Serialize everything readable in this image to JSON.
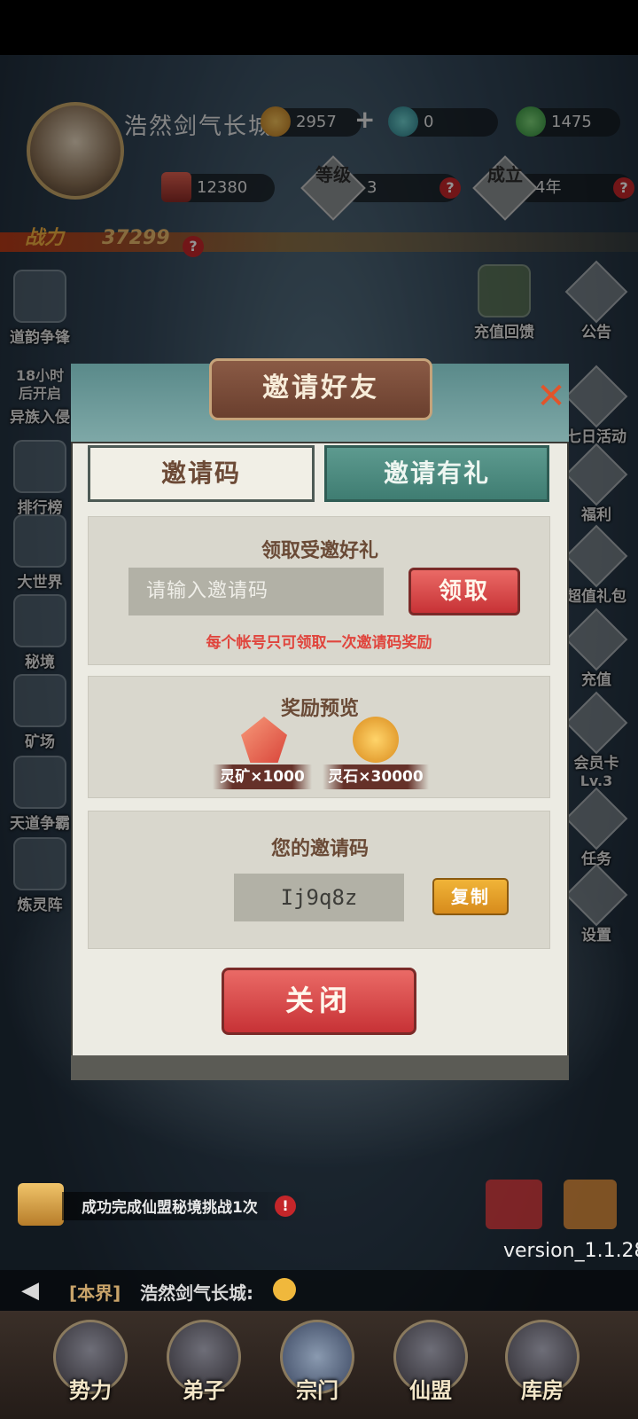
{
  "player": {
    "name": "浩然剑气长城",
    "spirit_stone": "2957",
    "plus": "+",
    "jade": "0",
    "leaf": "1475",
    "crystal": "12380",
    "level_badge": "等级",
    "level_value": "3",
    "founded_badge": "成立",
    "founded_value": "4年",
    "power_icon": "战力",
    "power": "37299"
  },
  "left_menu": [
    {
      "label": "道韵争锋",
      "name": "daoyun"
    },
    {
      "label": "18小时后开启",
      "name": "timer"
    },
    {
      "label": "异族入侵",
      "name": "invasion"
    },
    {
      "label": "排行榜",
      "name": "ranking"
    },
    {
      "label": "大世界",
      "name": "world"
    },
    {
      "label": "秘境",
      "name": "secret-realm"
    },
    {
      "label": "矿场",
      "name": "mine"
    },
    {
      "label": "天道争霸",
      "name": "tiandao"
    },
    {
      "label": "炼灵阵",
      "name": "lianling"
    }
  ],
  "right_menu": [
    {
      "label": "充值回馈",
      "name": "recharge-rebate"
    },
    {
      "label": "公告",
      "name": "notice"
    },
    {
      "label": "七日活动",
      "name": "seven-day"
    },
    {
      "label": "福利",
      "name": "welfare"
    },
    {
      "label": "超值礼包",
      "name": "gift-pack"
    },
    {
      "label": "充值",
      "name": "recharge"
    },
    {
      "label": "会员卡",
      "name": "vip-card"
    },
    {
      "label": "Lv.3",
      "name": "vip-level"
    },
    {
      "label": "任务",
      "name": "task"
    },
    {
      "label": "设置",
      "name": "settings"
    }
  ],
  "dialog": {
    "title": "邀请好友",
    "tab_code": "邀请码",
    "tab_reward": "邀请有礼",
    "claim_title": "领取受邀好礼",
    "input_placeholder": "请输入邀请码",
    "claim_button": "领取",
    "note": "每个帐号只可领取一次邀请码奖励",
    "preview_title": "奖励预览",
    "reward1": "灵矿×1000",
    "reward2": "灵石×30000",
    "mycode_title": "您的邀请码",
    "mycode": "Ij9q8z",
    "copy_button": "复制",
    "close_button": "关闭"
  },
  "bottom": {
    "task_note": "成功完成仙盟秘境挑战1次",
    "version": "version_1.1.28",
    "chat_channel": "[本界]",
    "chat_name": "浩然剑气长城:",
    "nav": [
      "势力",
      "弟子",
      "宗门",
      "仙盟",
      "库房"
    ]
  },
  "colors": {
    "accent_red": "#c73236",
    "teal": "#3f7d72",
    "note_red": "#e0453d",
    "brown_text": "#6a4a36"
  }
}
